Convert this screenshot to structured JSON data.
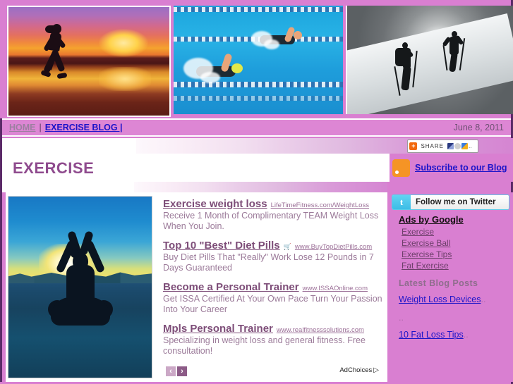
{
  "site": {
    "background_color": "#d97fd1",
    "border_color": "#5b2a68",
    "title": "EXERCISE",
    "title_color": "#8f4b8e"
  },
  "banner": {
    "images": [
      {
        "name": "runner-sunset-banner",
        "alt": "Woman running on beach at sunset"
      },
      {
        "name": "swimmers-pool-banner",
        "alt": "Two swimmers racing in a pool"
      },
      {
        "name": "snow-hikers-banner",
        "alt": "Two hikers climbing a snowy slope"
      }
    ]
  },
  "nav": {
    "home_label": "HOME",
    "separator": "|",
    "blog_label": "EXERCISE BLOG |",
    "date": "June 8, 2011",
    "home_color": "#9c7fa0",
    "blog_color": "#1c14c9"
  },
  "share": {
    "plus_glyph": "+",
    "label": "SHARE",
    "more_glyph": ".."
  },
  "subscribe": {
    "icon": "rss-icon",
    "label": "Subscribe to our Blog",
    "color": "#1c14c9"
  },
  "twitter": {
    "icon_glyph": "t",
    "label": "Follow me on Twitter"
  },
  "sidebar": {
    "ads_header": "Ads by Google",
    "ad_links": [
      {
        "label": "Exercise"
      },
      {
        "label": "Exercise Ball"
      },
      {
        "label": "Exercise Tips"
      },
      {
        "label": "Fat Exercise"
      }
    ],
    "latest_header": "Latest Blog Posts",
    "posts": [
      {
        "label": "Weight Loss Devices",
        "trail": ".."
      },
      {
        "label": "..",
        "trail": ""
      },
      {
        "label": "10 Fat Loss Tips",
        "trail": ".."
      }
    ]
  },
  "main": {
    "feature_image": {
      "name": "yoga-silhouette-image",
      "alt": "Person meditating in lotus pose at sunset"
    },
    "ads": [
      {
        "title": "Exercise weight loss",
        "url": "LifeTimeFitness.com/WeightLoss",
        "icon": "",
        "description": "Receive 1 Month of Complimentary TEAM Weight Loss When You Join."
      },
      {
        "title": "Top 10 \"Best\" Diet Pills",
        "url": "www.BuyTopDietPills.com",
        "icon": "cart-icon",
        "description": "Buy Diet Pills That \"Really\" Work Lose 12 Pounds in 7 Days Guaranteed"
      },
      {
        "title": "Become a Personal Trainer",
        "url": "www.ISSAOnline.com",
        "icon": "",
        "description": "Get ISSA Certified At Your Own Pace Turn Your Passion Into Your Career"
      },
      {
        "title": "Mpls Personal Trainer",
        "url": "www.realfitnesssolutions.com",
        "icon": "",
        "description": "Specializing in weight loss and general fitness. Free consultation!"
      }
    ],
    "pager": {
      "prev": "‹",
      "next": "›"
    },
    "adchoices": {
      "label": "AdChoices",
      "glyph": "▷"
    }
  }
}
